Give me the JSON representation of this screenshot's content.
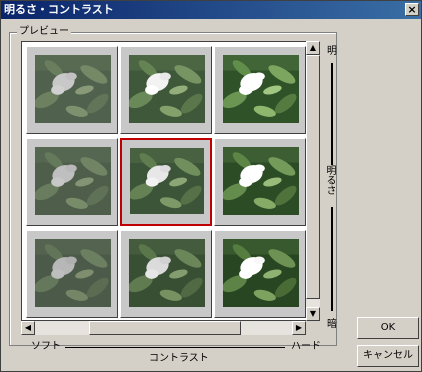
{
  "window": {
    "title": "明るさ・コントラスト",
    "close_glyph": "×"
  },
  "preview": {
    "group_label": "プレビュー",
    "thumbnails": [
      {
        "row": 0,
        "col": 0,
        "brightness": 0.95,
        "contrast": 0.7,
        "selected": false
      },
      {
        "row": 0,
        "col": 1,
        "brightness": 1.0,
        "contrast": 1.0,
        "selected": false
      },
      {
        "row": 0,
        "col": 2,
        "brightness": 1.05,
        "contrast": 1.3,
        "selected": false
      },
      {
        "row": 1,
        "col": 0,
        "brightness": 0.9,
        "contrast": 0.7,
        "selected": false
      },
      {
        "row": 1,
        "col": 1,
        "brightness": 0.95,
        "contrast": 1.0,
        "selected": true
      },
      {
        "row": 1,
        "col": 2,
        "brightness": 1.0,
        "contrast": 1.3,
        "selected": false
      },
      {
        "row": 2,
        "col": 0,
        "brightness": 0.85,
        "contrast": 0.7,
        "selected": false
      },
      {
        "row": 2,
        "col": 1,
        "brightness": 0.9,
        "contrast": 1.0,
        "selected": false
      },
      {
        "row": 2,
        "col": 2,
        "brightness": 0.95,
        "contrast": 1.3,
        "selected": false
      }
    ],
    "selected_color": "#c00000"
  },
  "brightness_scale": {
    "top_label": "明",
    "middle_label": "明るさ",
    "bottom_label": "暗"
  },
  "contrast_scale": {
    "left_label": "ソフト",
    "middle_label": "コントラスト",
    "right_label": "ハード"
  },
  "buttons": {
    "ok_label": "OK",
    "cancel_label": "キャンセル"
  },
  "scrollbar_glyphs": {
    "up": "▲",
    "down": "▼",
    "left": "◀",
    "right": "▶"
  }
}
